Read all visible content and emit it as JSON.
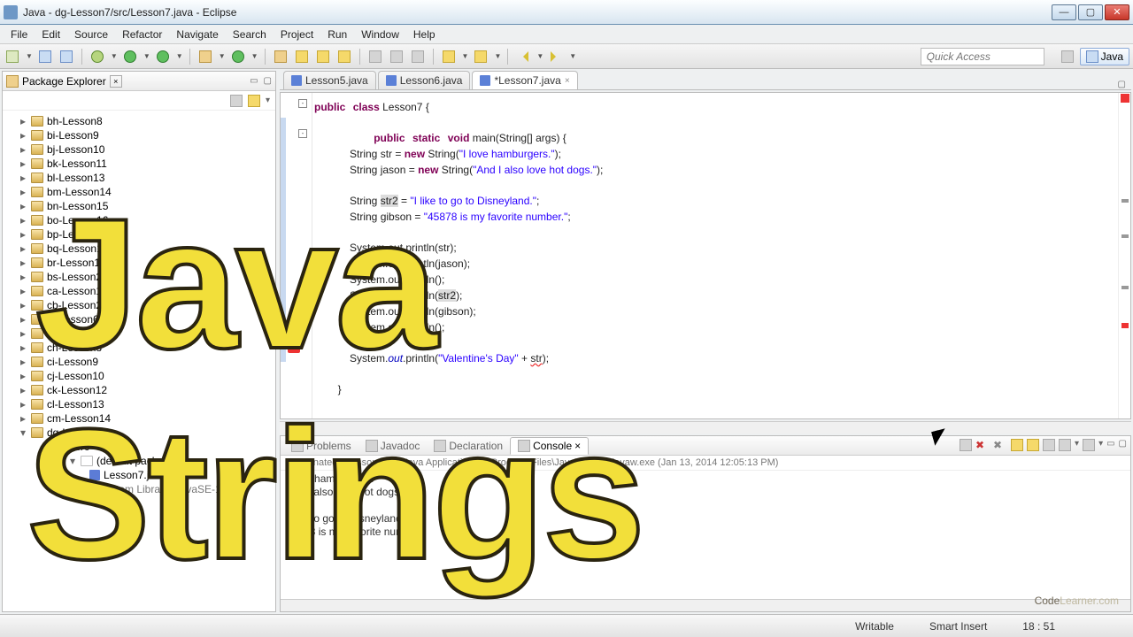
{
  "window": {
    "title": "Java - dg-Lesson7/src/Lesson7.java - Eclipse",
    "min": "—",
    "max": "▢",
    "close": "✕"
  },
  "menu": [
    "File",
    "Edit",
    "Source",
    "Refactor",
    "Navigate",
    "Search",
    "Project",
    "Run",
    "Window",
    "Help"
  ],
  "quick_access_placeholder": "Quick Access",
  "perspective": "Java",
  "package_explorer": {
    "title": "Package Explorer",
    "items": [
      "bh-Lesson8",
      "bi-Lesson9",
      "bj-Lesson10",
      "bk-Lesson11",
      "bl-Lesson13",
      "bm-Lesson14",
      "bn-Lesson15",
      "bo-Lesson16",
      "bp-Lesson17",
      "bq-Lesson18",
      "br-Lesson19",
      "bs-Lesson20",
      "ca-Lesson1",
      "cb-Lesson2",
      "cf-Lesson6",
      "cg-Lesson7",
      "ch-Lesson8",
      "ci-Lesson9",
      "cj-Lesson10",
      "ck-Lesson12",
      "cl-Lesson13",
      "cm-Lesson14"
    ],
    "default_pkg": "(default package)",
    "java_file": "Lesson7.java",
    "jre": "JRE System Library [JavaSE-1.7]"
  },
  "editor": {
    "tabs": [
      {
        "label": "Lesson5.java",
        "active": false
      },
      {
        "label": "Lesson6.java",
        "active": false
      },
      {
        "label": "*Lesson7.java",
        "active": true
      }
    ],
    "code": {
      "l1a": "public",
      "l1b": "class",
      "l1c": " Lesson7 {",
      "l3a": "public",
      "l3b": "static",
      "l3c": "void",
      "l3d": " main(String[] args) {",
      "l4a": "            String str = ",
      "l4b": "new",
      "l4c": " String(",
      "l4d": "\"I love hamburgers.\"",
      "l4e": ");",
      "l5a": "            String jason = ",
      "l5b": "new",
      "l5c": " String(",
      "l5d": "\"And I also love hot dogs.\"",
      "l5e": ");",
      "l7a": "            String ",
      "l7b": "str2",
      "l7c": " = ",
      "l7d": "\"I like to go to Disneyland.\"",
      "l7e": ";",
      "l8a": "            String gibson = ",
      "l8d": "\"45878 is my favorite number.\"",
      "l8e": ";",
      "l10": "            System.out.println(str);",
      "l11": "            System.out.println(jason);",
      "l12": "            System.out.println();",
      "l13a": "            System.out.println(",
      "l13b": "str2",
      "l13c": ");",
      "l14": "            System.out.println(gibson);",
      "l15": "            System.out.println();",
      "l17a": "            System.",
      "l17b": "out",
      "l17c": ".println(",
      "l17d": "\"Valentine's Day\"",
      "l17e": " + ",
      "l17f": "str",
      "l17g": ");",
      "l19": "        }"
    }
  },
  "bottom": {
    "tabs": [
      "Problems",
      "Javadoc",
      "Declaration",
      "Console"
    ],
    "active_tab": 3,
    "terminated": "<terminated> Lesson7 (3) [Java Application] C:\\Program Files\\Java\\jre7\\bin\\javaw.exe (Jan 13, 2014 12:05:13 PM)",
    "output": "I love hamburgers.\nAnd I also love hot dogs.\n\nI like to go to Disneyland.\n45878 is my favorite number."
  },
  "status": {
    "writable": "Writable",
    "mode": "Smart Insert",
    "pos": "18 : 51"
  },
  "overlay": {
    "line1": "Java",
    "line2": "Strings",
    "wm_a": "Code",
    "wm_b": "Learner",
    "wm_c": ".com"
  }
}
